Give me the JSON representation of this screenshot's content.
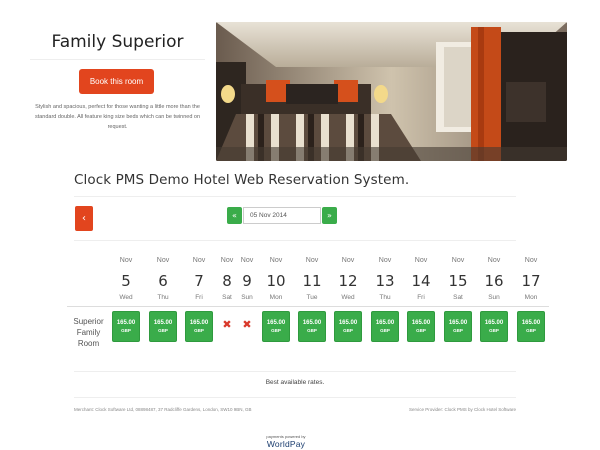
{
  "room": {
    "title": "Family Superior",
    "book_label": "Book this room",
    "description": "Stylish and spacious, perfect for those wanting a little more than the standard double. All feature king size beds which can be twinned on request."
  },
  "hotel": {
    "title": "Clock PMS Demo Hotel Web Reservation System."
  },
  "nav": {
    "prev_label": "‹",
    "date_prev_label": "«",
    "date_next_label": "»",
    "date_value": "05 Nov 2014"
  },
  "calendar": {
    "days": [
      {
        "month": "Nov",
        "day": "5",
        "weekday": "Wed"
      },
      {
        "month": "Nov",
        "day": "6",
        "weekday": "Thu"
      },
      {
        "month": "Nov",
        "day": "7",
        "weekday": "Fri"
      },
      {
        "month": "Nov",
        "day": "8",
        "weekday": "Sat"
      },
      {
        "month": "Nov",
        "day": "9",
        "weekday": "Sun"
      },
      {
        "month": "Nov",
        "day": "10",
        "weekday": "Mon"
      },
      {
        "month": "Nov",
        "day": "11",
        "weekday": "Tue"
      },
      {
        "month": "Nov",
        "day": "12",
        "weekday": "Wed"
      },
      {
        "month": "Nov",
        "day": "13",
        "weekday": "Thu"
      },
      {
        "month": "Nov",
        "day": "14",
        "weekday": "Fri"
      },
      {
        "month": "Nov",
        "day": "15",
        "weekday": "Sat"
      },
      {
        "month": "Nov",
        "day": "16",
        "weekday": "Sun"
      },
      {
        "month": "Nov",
        "day": "17",
        "weekday": "Mon"
      }
    ]
  },
  "rates": {
    "room_label": "Superior Family Room",
    "cells": [
      {
        "amount": "165.00",
        "currency": "GBP"
      },
      {
        "amount": "165.00",
        "currency": "GBP"
      },
      {
        "amount": "165.00",
        "currency": "GBP"
      },
      {
        "unavailable": "✖"
      },
      {
        "unavailable": "✖"
      },
      {
        "amount": "165.00",
        "currency": "GBP"
      },
      {
        "amount": "165.00",
        "currency": "GBP"
      },
      {
        "amount": "165.00",
        "currency": "GBP"
      },
      {
        "amount": "165.00",
        "currency": "GBP"
      },
      {
        "amount": "165.00",
        "currency": "GBP"
      },
      {
        "amount": "165.00",
        "currency": "GBP"
      },
      {
        "amount": "165.00",
        "currency": "GBP"
      },
      {
        "amount": "165.00",
        "currency": "GBP"
      }
    ],
    "best_rates": "Best available rates."
  },
  "footer": {
    "merchant": "Merchant: Clock Software Ltd, 08898487, 37 Radcliffe Gardens, London, SW10 9BN, GB",
    "provider": "Service Provider: Clock PMS by Clock Hotel Software",
    "payments_small": "payments powered by",
    "payments_brand": "WorldPay"
  },
  "colors": {
    "accent_red": "#e2451e",
    "accent_green": "#3aac4a",
    "unavailable_red": "#d9392b"
  }
}
